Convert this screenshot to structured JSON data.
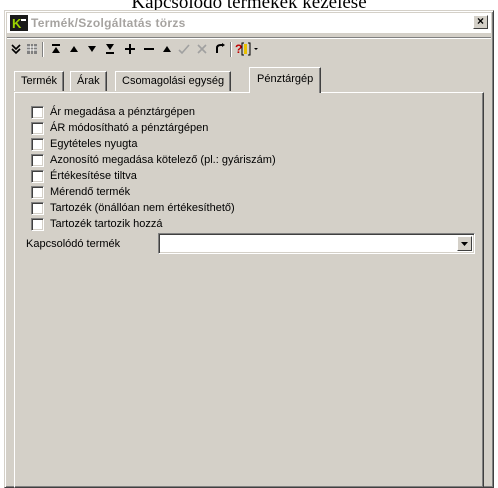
{
  "page": {
    "heading": "Kapcsolódó termékek kezelése"
  },
  "window": {
    "title": "Termék/Szolgáltatás törzs",
    "close_label": "×"
  },
  "toolbar": {
    "items": [
      {
        "name": "collapse-icon"
      },
      {
        "name": "grid-icon"
      },
      {
        "name": "first-record-icon"
      },
      {
        "name": "prior-record-icon"
      },
      {
        "name": "next-record-icon"
      },
      {
        "name": "last-record-icon"
      },
      {
        "name": "insert-record-icon"
      },
      {
        "name": "delete-record-icon"
      },
      {
        "name": "edit-record-icon"
      },
      {
        "name": "post-edit-icon"
      },
      {
        "name": "cancel-edit-icon"
      },
      {
        "name": "refresh-icon"
      },
      {
        "name": "filter-icon"
      }
    ]
  },
  "tabs": [
    {
      "label": "Termék"
    },
    {
      "label": "Árak"
    },
    {
      "label": "Csomagolási egység"
    },
    {
      "label": "Pénztárgép",
      "active": true
    }
  ],
  "options": [
    {
      "label": "Ár megadása a pénztárgépen",
      "checked": false
    },
    {
      "label": "ÁR módosítható a pénztárgépen",
      "checked": false
    },
    {
      "label": "Egytételes nyugta",
      "checked": false
    },
    {
      "label": "Azonosító megadása kötelező (pl.: gyáriszám)",
      "checked": false
    },
    {
      "label": "Értékesítése tiltva",
      "checked": false
    },
    {
      "label": "Mérendő termék",
      "checked": false
    },
    {
      "label": "Tartozék (önállóan nem értékesíthető)",
      "checked": false
    },
    {
      "label": "Tartozék tartozik hozzá",
      "checked": false
    }
  ],
  "related_product": {
    "label": "Kapcsolódó termék",
    "value": ""
  },
  "colors": {
    "window_bg": "#d4d0c8",
    "title_text": "#a6a3a0",
    "icon_red": "#c00000",
    "icon_yellow": "#e8c000"
  }
}
